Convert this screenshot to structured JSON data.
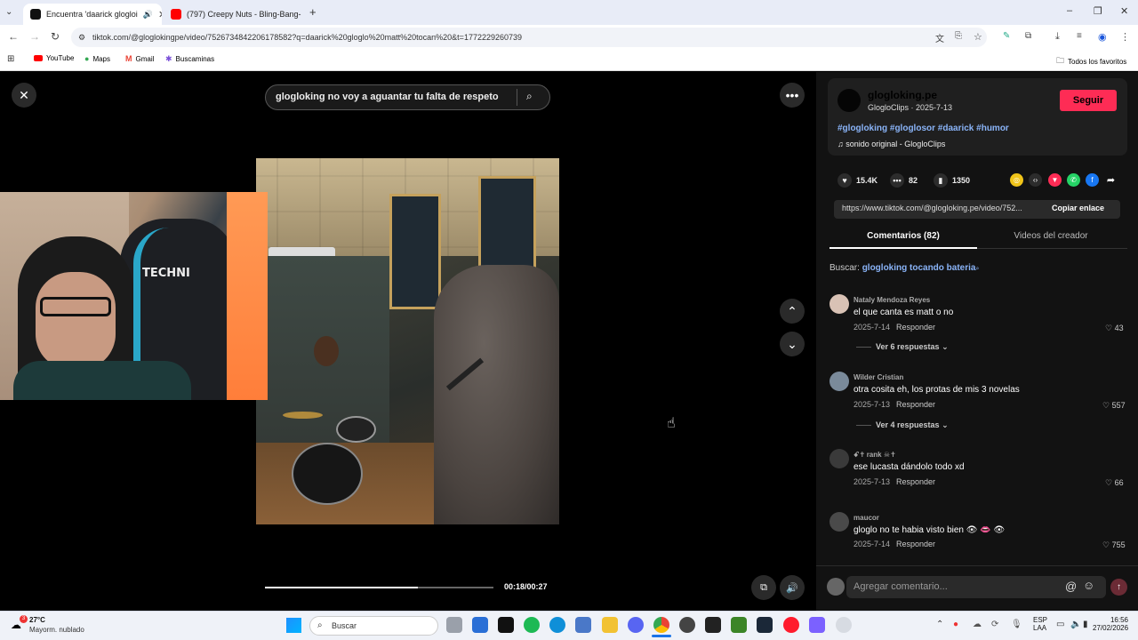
{
  "browser": {
    "tabs": [
      {
        "label": "Encuentra 'daarick glogloi",
        "active": true
      },
      {
        "label": "(797) Creepy Nuts - Bling-Bang-",
        "active": false
      }
    ],
    "new_tab": "+",
    "url": "tiktok.com/@gloglokingpe/video/7526734842206178582?q=daarick%20gloglo%20matt%20tocan%20&t=1772229260739",
    "bookmarks": [
      "YouTube",
      "Maps",
      "Gmail",
      "Buscaminas"
    ],
    "all_bookmarks": "Todos los favoritos"
  },
  "video": {
    "search_query": "glogloking no voy a aguantar tu falta de respeto",
    "time": "00:18/00:27",
    "progress": 0.67,
    "webcam_logo": "TECHNI"
  },
  "creator": {
    "name": "glogloking.pe",
    "subtitle": "GlogloClips · 2025-7-13",
    "follow_label": "Seguir",
    "hashtags": "#glogloking #gloglosor #daarick #humor",
    "sound": "sonido original - GlogloClips"
  },
  "stats": {
    "likes": "15.4K",
    "comments": "82",
    "saves": "1350"
  },
  "share": {
    "link": "https://www.tiktok.com/@glogloking.pe/video/752...",
    "copy_label": "Copiar enlace"
  },
  "tabs": {
    "comments": "Comentarios (82)",
    "videos": "Videos del creador"
  },
  "search_suggest": {
    "prefix": "Buscar:",
    "term": "glogloking tocando bateria"
  },
  "comments": [
    {
      "user": "Nataly Mendoza Reyes",
      "text": "el que canta es matt o no",
      "date": "2025-7-14",
      "reply": "Responder",
      "likes": "43",
      "more": "Ver 6 respuestas"
    },
    {
      "user": "Wilder Cristian",
      "text": "otra cosita eh, los protas de mis 3 novelas",
      "date": "2025-7-13",
      "reply": "Responder",
      "likes": "557",
      "more": "Ver 4 respuestas"
    },
    {
      "user": "ꗃ✝ rank ☠✝",
      "text": "ese lucasta dándolo todo xd",
      "date": "2025-7-13",
      "reply": "Responder",
      "likes": "66",
      "more": ""
    },
    {
      "user": "maucor",
      "text": "gloglo no te habia visto bien 👁 👄 👁",
      "date": "2025-7-14",
      "reply": "Responder",
      "likes": "755",
      "more": ""
    }
  ],
  "comment_box": {
    "placeholder": "Agregar comentario..."
  },
  "taskbar": {
    "weather_temp": "27°C",
    "weather_desc": "Mayorm. nublado",
    "search": "Buscar",
    "lang": "ESP",
    "lang2": "LAA",
    "time": "16:56",
    "date": "27/02/2026"
  }
}
